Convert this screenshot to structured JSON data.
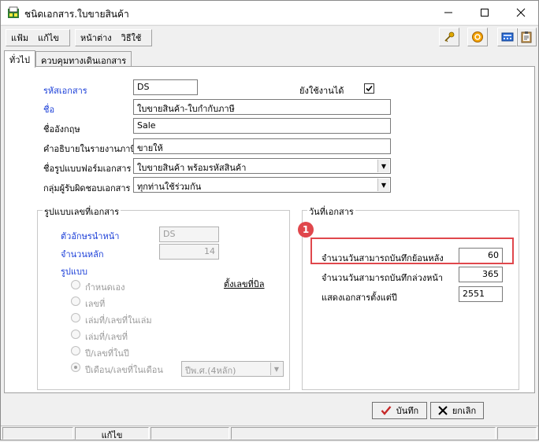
{
  "window": {
    "title": "ชนิดเอกสาร.ใบขายสินค้า"
  },
  "menu": {
    "items": [
      "แฟ้ม",
      "แก้ไข",
      "หน้าต่าง",
      "วิธีใช้"
    ]
  },
  "tabs": [
    "ทั่วไป",
    "ควบคุมทางเดินเอกสาร"
  ],
  "form": {
    "code_label": "รหัสเอกสาร",
    "code_value": "DS",
    "usable_label": "ยังใช้งานได้",
    "usable_checked": true,
    "name_label": "ชื่อ",
    "name_value": "ใบขายสินค้า-ใบกำกับภาษี",
    "eng_name_label": "ชื่ออังกฤษ",
    "eng_name_value": "Sale",
    "tax_desc_label": "คำอธิบายในรายงานภาษี",
    "tax_desc_value": "ขายให้",
    "form_name_label": "ชื่อรูปแบบฟอร์มเอกสาร",
    "form_name_value": "ใบขายสินค้า พร้อมรหัสสินค้า",
    "resp_group_label": "กลุ่มผู้รับผิดชอบเอกสาร",
    "resp_group_value": "ทุกท่านใช้ร่วมกัน"
  },
  "numbering": {
    "title": "รูปแบบเลขที่เอกสาร",
    "prefix_label": "ตัวอักษรนำหน้า",
    "prefix_value": "DS",
    "digits_label": "จำนวนหลัก",
    "digits_value": "14",
    "format_label": "รูปแบบ",
    "set_number_link": "ตั้งเลขที่บิล",
    "options": [
      "กำหนดเอง",
      "เลขที่",
      "เล่มที่/เลขที่ในเล่ม",
      "เล่มที่/เลขที่",
      "ปี/เลขที่ในปี",
      "ปีเดือน/เลขที่ในเดือน"
    ],
    "selected_option": "ปีเดือน/เลขที่ในเดือน",
    "year_format_value": "ปีพ.ศ.(4หลัก)"
  },
  "dates": {
    "title": "วันที่เอกสาร",
    "back_label": "จำนวนวันสามารถบันทึกย้อนหลัง",
    "back_value": "60",
    "ahead_label": "จำนวนวันสามารถบันทึกล่วงหน้า",
    "ahead_value": "365",
    "show_since_label": "แสดงเอกสารตั้งแต่ปี",
    "show_since_value": "2551"
  },
  "annotation": {
    "badge": "1",
    "color": "#e0474c"
  },
  "buttons": {
    "save": "บันทึก",
    "cancel": "ยกเลิก"
  },
  "status": {
    "mode": "แก้ไข"
  },
  "colors": {
    "label_blue": "#1a3ed8",
    "disabled_gray": "#9a9a9a"
  }
}
